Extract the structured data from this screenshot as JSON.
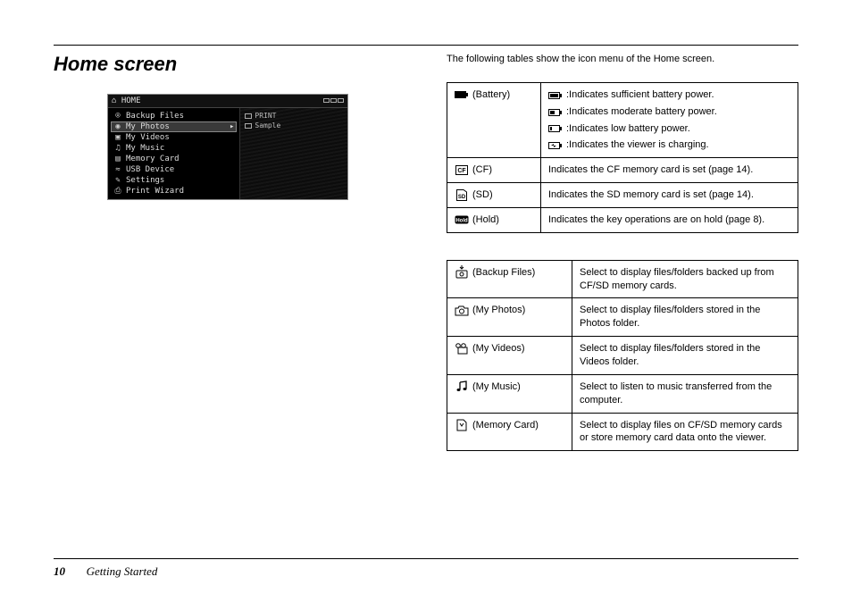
{
  "heading": "Home screen",
  "intro": "The following tables show the icon menu of the Home screen.",
  "screenshot": {
    "title": "HOME",
    "menu": [
      "Backup Files",
      "My Photos",
      "My Videos",
      "My Music",
      "Memory Card",
      "USB Device",
      "Settings",
      "Print Wizard"
    ],
    "selected_index": 1,
    "side": [
      "PRINT",
      "Sample"
    ]
  },
  "table1": [
    {
      "label": "(Battery)",
      "lines": [
        ":Indicates sufficient battery power.",
        ":Indicates moderate battery power.",
        ":Indicates low battery power.",
        ":Indicates the viewer is charging."
      ]
    },
    {
      "label": "(CF)",
      "desc": "Indicates the CF memory card is set (page 14)."
    },
    {
      "label": "(SD)",
      "desc": "Indicates the SD memory card is set (page 14)."
    },
    {
      "label": "(Hold)",
      "desc": "Indicates the key operations are on hold (page 8)."
    }
  ],
  "table2": [
    {
      "label": "(Backup Files)",
      "desc": "Select to display files/folders backed up from CF/SD memory cards."
    },
    {
      "label": "(My Photos)",
      "desc": "Select to display files/folders stored in the Photos folder."
    },
    {
      "label": "(My Videos)",
      "desc": "Select to display files/folders stored in the Videos folder."
    },
    {
      "label": "(My Music)",
      "desc": "Select to listen to music transferred from the computer."
    },
    {
      "label": "(Memory Card)",
      "desc": "Select to display files on CF/SD memory cards or store memory card data onto the viewer."
    }
  ],
  "footer": {
    "page": "10",
    "section": "Getting Started"
  }
}
